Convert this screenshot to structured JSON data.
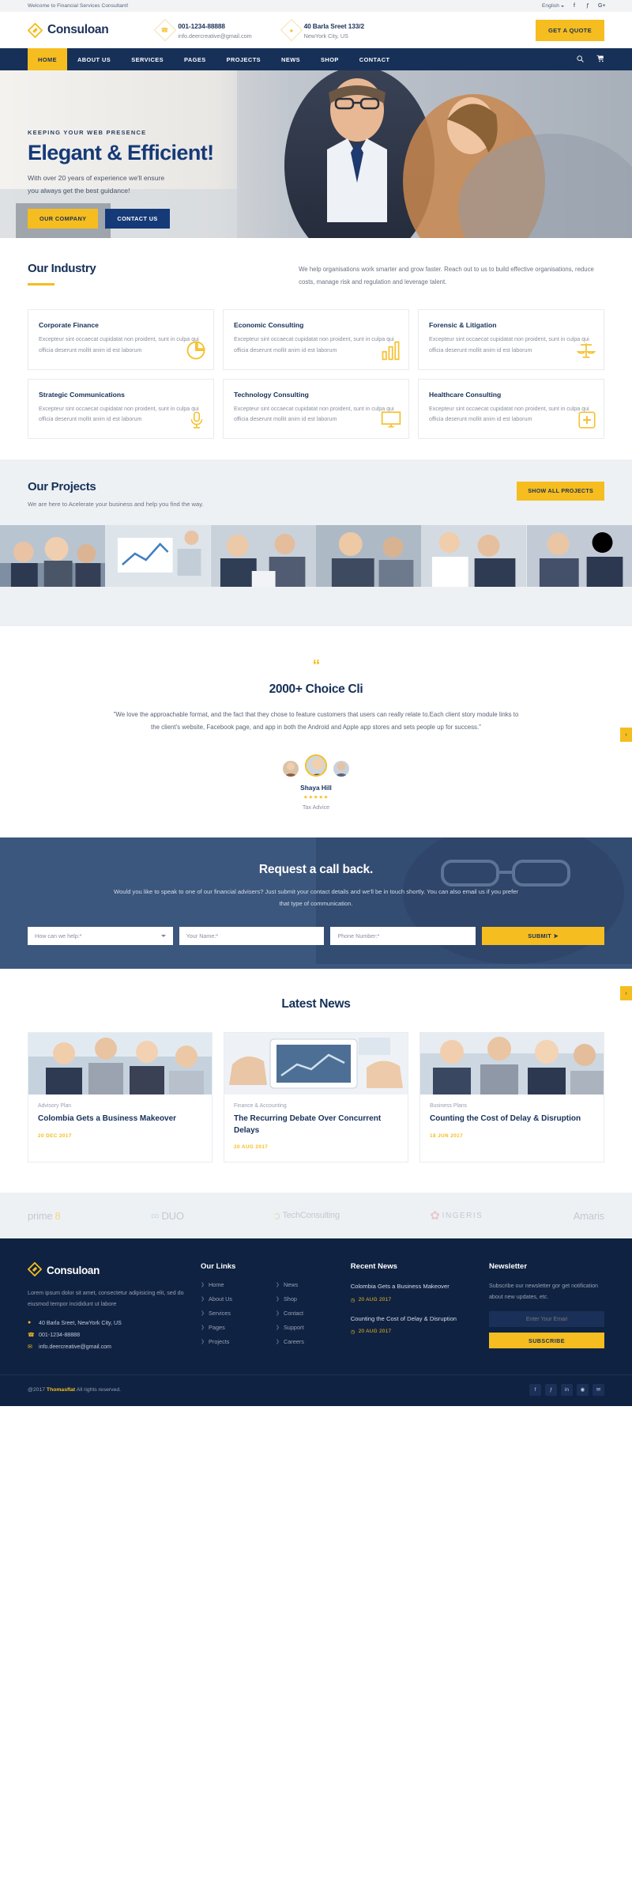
{
  "topbar": {
    "welcome": "Welcome to Financial Services Consultant!",
    "language": "English",
    "socials": [
      "f",
      "ƒ",
      "G+"
    ]
  },
  "header": {
    "brand": "Consuloan",
    "phone": "001-1234-88888",
    "email": "info.deercreative@gmail.com",
    "address_line1": "40 Barla Sreet 133/2",
    "address_line2": "NewYork City, US",
    "quote_button": "GET A QUOTE"
  },
  "nav": {
    "items": [
      {
        "label": "HOME",
        "active": true
      },
      {
        "label": "ABOUT US",
        "active": false
      },
      {
        "label": "SERVICES",
        "active": false
      },
      {
        "label": "PAGES",
        "active": false
      },
      {
        "label": "PROJECTS",
        "active": false
      },
      {
        "label": "NEWS",
        "active": false
      },
      {
        "label": "SHOP",
        "active": false
      },
      {
        "label": "CONTACT",
        "active": false
      }
    ],
    "search_icon": "⚲",
    "cart_icon": "🛒"
  },
  "hero": {
    "kicker": "KEEPING YOUR WEB PRESENCE",
    "title": "Elegant & Efficient!",
    "subtitle": "With over 20 years of experience we'll ensure\nyou always get the best guidance!",
    "btn_primary": "OUR COMPANY",
    "btn_secondary": "CONTACT US"
  },
  "industry": {
    "title": "Our Industry",
    "intro": "We help organisations work smarter and grow faster. Reach out to us to build effective organisations, reduce costs, manage risk and regulation and leverage talent.",
    "body": "Excepteur sint occaecat cupidatat non proident, sunt in culpa qui officia deserunt mollit anim id est laborum",
    "cards": [
      {
        "title": "Corporate Finance",
        "icon": "◔"
      },
      {
        "title": "Economic Consulting",
        "icon": "ᴴ"
      },
      {
        "title": "Forensic & Litigation",
        "icon": "☗"
      },
      {
        "title": "Strategic Communications",
        "icon": "⚇"
      },
      {
        "title": "Technology Consulting",
        "icon": "⌸"
      },
      {
        "title": "Healthcare Consulting",
        "icon": "✚"
      }
    ]
  },
  "projects": {
    "title": "Our Projects",
    "subtitle": "We are here to Acelerate your business and help you find the way.",
    "button": "SHOW ALL PROJECTS",
    "arrow": "›",
    "count": 6
  },
  "testimonial": {
    "quote_icon": "“",
    "title": "2000+ Choice Cli",
    "text": "\"We love the approachable format, and the fact that they chose to feature customers that users can really relate to.Each client story module links to the client's website, Facebook page, and app in both the Android and Apple app stores and sets people up for success.\"",
    "author": "Shaya Hill",
    "stars": "★★★★★",
    "role": "Tax Advice",
    "arrow": "›"
  },
  "callback": {
    "title": "Request a call back.",
    "text": "Would you like to speak to one of our financial advisers? Just submit your contact details and we'll be in touch shortly. You can also email us if you prefer that type of communication.",
    "select_placeholder": "How can we help:*",
    "name_placeholder": "Your Name:*",
    "phone_placeholder": "Phone Number:*",
    "submit": "SUBMIT  ➤"
  },
  "news": {
    "title": "Latest News",
    "arrow": "›",
    "items": [
      {
        "category": "Advisory Plan",
        "title": "Colombia Gets a Business Makeover",
        "date": "20 DEC 2017"
      },
      {
        "category": "Finance & Accounting",
        "title": "The Recurring Debate Over Concurrent Delays",
        "date": "20 AUG 2017"
      },
      {
        "category": "Business Plans",
        "title": "Counting the Cost of Delay & Disruption",
        "date": "18 JUN 2017"
      }
    ]
  },
  "brands": [
    {
      "name": "prime",
      "mark": "8"
    },
    {
      "name": "DUO",
      "mark": "∞"
    },
    {
      "name": "TechConsulting",
      "mark": "ɔ"
    },
    {
      "name": "INGERIS",
      "mark": "✿"
    },
    {
      "name": "Amaris",
      "mark": ""
    }
  ],
  "footer": {
    "brand": "Consuloan",
    "description": "Lorem ipsum dolor sit amet, consectetur adipisicing elit, sed do eiusmod tempor incididunt ut labore",
    "address": "40 Barla Sreet, NewYork City, US",
    "phone": "001-1234-88888",
    "email": "info.deercreative@gmail.com",
    "links_heading": "Our Links",
    "links_col1": [
      "Home",
      "About Us",
      "Services",
      "Pages",
      "Projects"
    ],
    "links_col2": [
      "News",
      "Shop",
      "Contact",
      "Support",
      "Careers"
    ],
    "recent_heading": "Recent News",
    "recent": [
      {
        "title": "Colombia Gets a Business Makeover",
        "date": "20 AUG 2017"
      },
      {
        "title": "Counting the Cost of Delay & Disruption",
        "date": "20 AUG 2017"
      }
    ],
    "newsletter_heading": "Newsletter",
    "newsletter_text": "Subscribe our newsletter gor get notification about new updates, etc.",
    "newsletter_placeholder": "Enter Your Email",
    "newsletter_button": "SUBSCRIBE",
    "copyright_pre": "@2017 ",
    "copyright_brand": "Thomasflat",
    "copyright_post": " All rights reserved.",
    "socials": [
      "f",
      "ƒ",
      "in",
      "◉",
      "✉"
    ]
  }
}
